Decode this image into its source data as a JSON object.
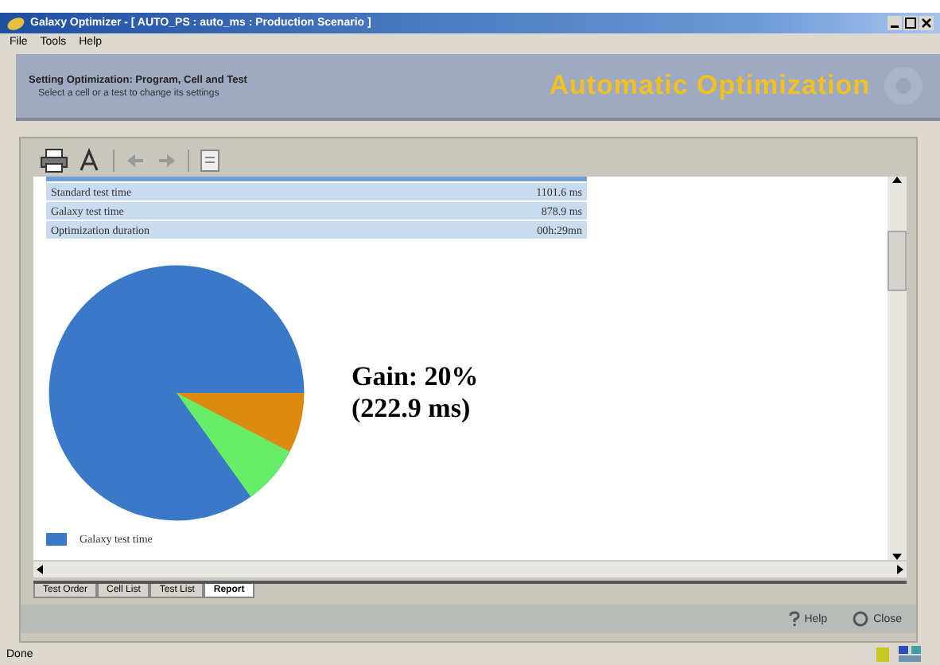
{
  "window": {
    "title": "Galaxy Optimizer - [ AUTO_PS : auto_ms : Production Scenario ]"
  },
  "menu": [
    "File",
    "Tools",
    "Help"
  ],
  "header": {
    "heading": "Setting Optimization: Program, Cell and Test",
    "subheading": "Select a cell or a test to change its settings",
    "banner": "Automatic Optimization"
  },
  "summary_rows": [
    {
      "label": "Standard test time",
      "value": "1101.6 ms"
    },
    {
      "label": "Galaxy test time",
      "value": "878.9 ms"
    },
    {
      "label": "Optimization duration",
      "value": "00h:29mn"
    }
  ],
  "gain": {
    "line_1": "Gain: 20%",
    "line_2": "(222.9 ms)"
  },
  "legend": [
    {
      "label": "Galaxy test time",
      "color": "#3a78c8"
    }
  ],
  "tabs": [
    {
      "label": "Test Order",
      "selected": false
    },
    {
      "label": "Cell List",
      "selected": false
    },
    {
      "label": "Test List",
      "selected": false
    },
    {
      "label": "Report",
      "selected": true
    }
  ],
  "buttons": [
    {
      "label": "Help",
      "kind": "help"
    },
    {
      "label": "Close",
      "kind": "close"
    }
  ],
  "status_bar": "Done"
}
